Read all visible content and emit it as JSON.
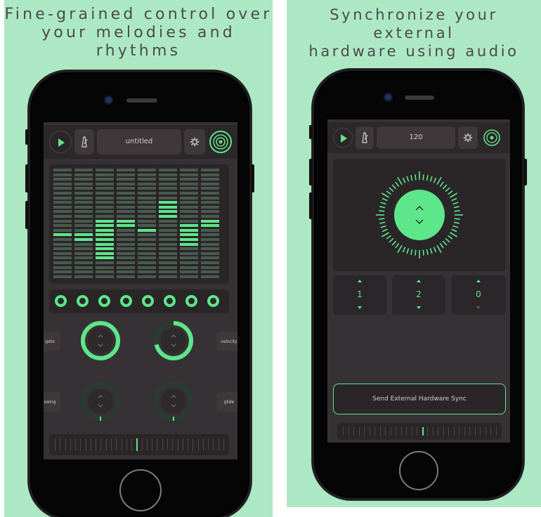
{
  "left": {
    "caption_line1": "Fine-grained control over",
    "caption_line2": "your melodies and rhythms",
    "toolbar": {
      "title": "untitled"
    },
    "sequencer": {
      "steps": 8,
      "active_rows": [
        14,
        15,
        19,
        12,
        13,
        10,
        16,
        12
      ],
      "active_len": [
        1,
        2,
        9,
        2,
        1,
        4,
        5,
        2
      ]
    },
    "knob_labels": {
      "gate": "gate",
      "velocity": "velocity",
      "swing": "swing",
      "glide": "glide"
    },
    "accent": "#5ee68a",
    "background": "#ade8c4"
  },
  "right": {
    "caption_line1": "Synchronize your external",
    "caption_line2": "hardware using audio",
    "toolbar": {
      "tempo": "120"
    },
    "counters": [
      "1",
      "2",
      "0"
    ],
    "sync_button": "Send External Hardware Sync"
  }
}
